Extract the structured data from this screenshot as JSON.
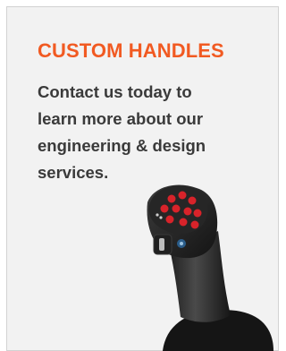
{
  "promo": {
    "title": "CUSTOM HANDLES",
    "body_lines": [
      "Contact us today to",
      "learn more about our",
      "engineering & design",
      "services."
    ],
    "image": "joystick-handle-photo"
  },
  "colors": {
    "title": "#f15a22",
    "body_text": "#3a3a3a",
    "card_bg": "#f2f2f2",
    "button_red": "#d8232a"
  }
}
